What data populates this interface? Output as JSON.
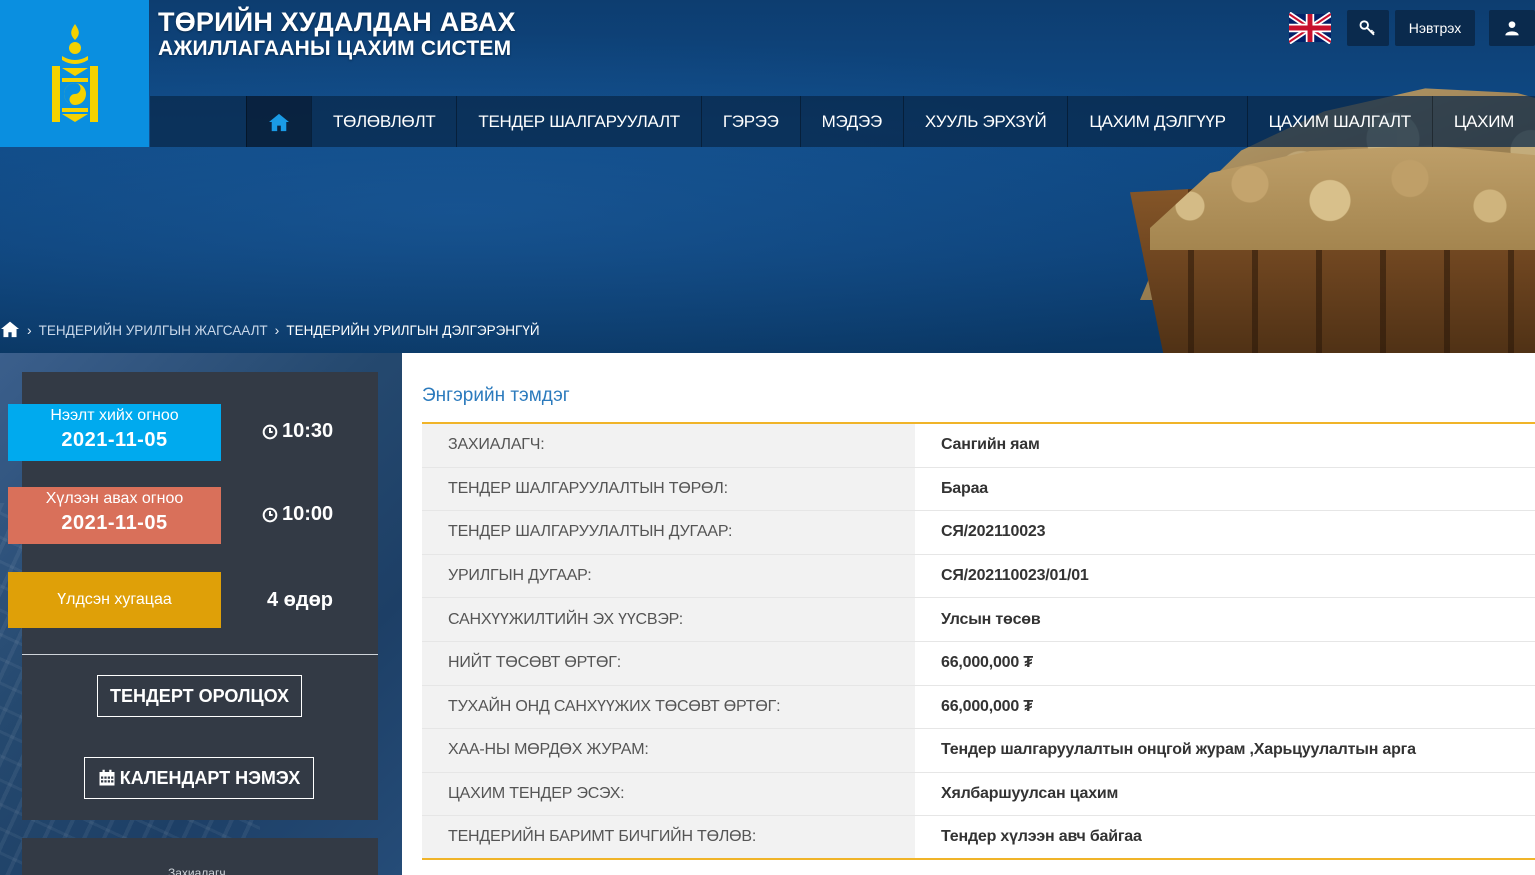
{
  "brand": {
    "line1": "ТӨРИЙН ХУДАЛДАН АВАХ",
    "line2": "АЖИЛЛАГААНЫ ЦАХИМ СИСТЕМ"
  },
  "topbar": {
    "login_label": "Нэвтрэх"
  },
  "nav": {
    "items": [
      "ТӨЛӨВЛӨЛТ",
      "ТЕНДЕР ШАЛГАРУУЛАЛТ",
      "ГЭРЭЭ",
      "МЭДЭЭ",
      "ХУУЛЬ ЭРХЗҮЙ",
      "ЦАХИМ ДЭЛГҮҮР",
      "ЦАХИМ ШАЛГАЛТ",
      "ЦАХИМ"
    ]
  },
  "breadcrumb": {
    "parent": "ТЕНДЕРИЙН УРИЛГЫН ЖАГСААЛТ",
    "current": "ТЕНДЕРИЙН УРИЛГЫН ДЭЛГЭРЭНГҮЙ"
  },
  "sidebar": {
    "open": {
      "label": "Нээлт хийх огноо",
      "date": "2021-11-05",
      "time": "10:30"
    },
    "close": {
      "label": "Хүлээн авах огноо",
      "date": "2021-11-05",
      "time": "10:00"
    },
    "remaining": {
      "label": "Үлдсэн хугацаа",
      "value": "4 өдөр"
    },
    "join_button": "ТЕНДЕРТ ОРОЛЦОХ",
    "calendar_button": "КАЛЕНДАРТ НЭМЭХ",
    "footer_text": "Захиалагч"
  },
  "main": {
    "section_title": "Энгэрийн тэмдэг",
    "rows": [
      {
        "label": "ЗАХИАЛАГЧ:",
        "value": "Сангийн яам"
      },
      {
        "label": "ТЕНДЕР ШАЛГАРУУЛАЛТЫН ТӨРӨЛ:",
        "value": "Бараа"
      },
      {
        "label": "ТЕНДЕР ШАЛГАРУУЛАЛТЫН ДУГААР:",
        "value": "СЯ/202110023"
      },
      {
        "label": "УРИЛГЫН ДУГААР:",
        "value": "СЯ/202110023/01/01"
      },
      {
        "label": "САНХҮҮЖИЛТИЙН ЭХ ҮҮСВЭР:",
        "value": "Улсын төсөв"
      },
      {
        "label": "НИЙТ ТӨСӨВТ ӨРТӨГ:",
        "value": "66,000,000 ₮"
      },
      {
        "label": "ТУХАЙН ОНД САНХҮҮЖИХ ТӨСӨВТ ӨРТӨГ:",
        "value": "66,000,000 ₮"
      },
      {
        "label": "ХАА-НЫ МӨРДӨХ ЖУРАМ:",
        "value": "Тендер шалгаруулалтын онцгой журам ,Харьцуулалтын арга"
      },
      {
        "label": "ЦАХИМ ТЕНДЕР ЭСЭХ:",
        "value": "Хялбаршуулсан цахим"
      },
      {
        "label": "ТЕНДЕРИЙН БАРИМТ БИЧГИЙН ТӨЛӨВ:",
        "value": "Тендер хүлээн авч байгаа"
      }
    ]
  },
  "colors": {
    "logo_bg": "#0a8fe0",
    "open_box": "#00aaee",
    "close_box": "#d9705a",
    "remain_box": "#dfa008",
    "accent_line": "#f0b429",
    "title_blue": "#2c7bbd"
  }
}
